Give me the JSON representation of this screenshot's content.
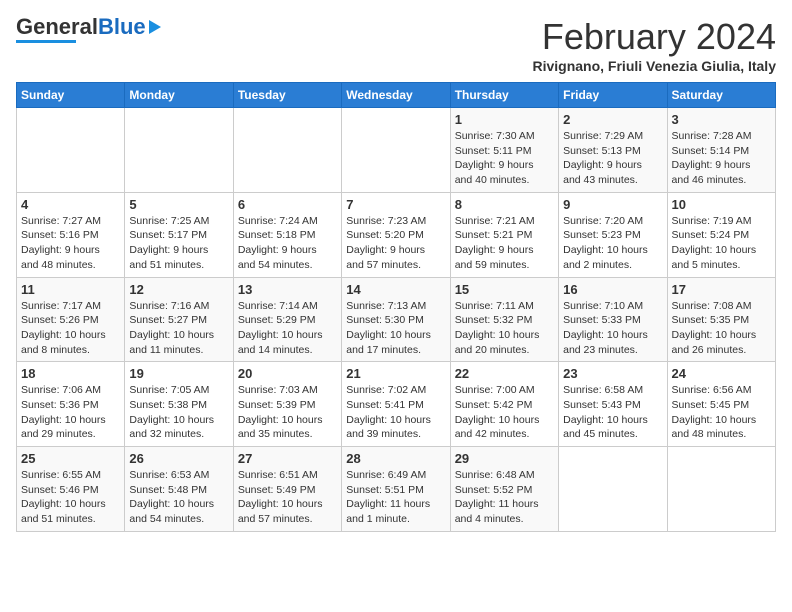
{
  "header": {
    "logo_general": "General",
    "logo_blue": "Blue",
    "title": "February 2024",
    "location": "Rivignano, Friuli Venezia Giulia, Italy"
  },
  "days_of_week": [
    "Sunday",
    "Monday",
    "Tuesday",
    "Wednesday",
    "Thursday",
    "Friday",
    "Saturday"
  ],
  "weeks": [
    [
      {
        "num": "",
        "info": ""
      },
      {
        "num": "",
        "info": ""
      },
      {
        "num": "",
        "info": ""
      },
      {
        "num": "",
        "info": ""
      },
      {
        "num": "1",
        "info": "Sunrise: 7:30 AM\nSunset: 5:11 PM\nDaylight: 9 hours\nand 40 minutes."
      },
      {
        "num": "2",
        "info": "Sunrise: 7:29 AM\nSunset: 5:13 PM\nDaylight: 9 hours\nand 43 minutes."
      },
      {
        "num": "3",
        "info": "Sunrise: 7:28 AM\nSunset: 5:14 PM\nDaylight: 9 hours\nand 46 minutes."
      }
    ],
    [
      {
        "num": "4",
        "info": "Sunrise: 7:27 AM\nSunset: 5:16 PM\nDaylight: 9 hours\nand 48 minutes."
      },
      {
        "num": "5",
        "info": "Sunrise: 7:25 AM\nSunset: 5:17 PM\nDaylight: 9 hours\nand 51 minutes."
      },
      {
        "num": "6",
        "info": "Sunrise: 7:24 AM\nSunset: 5:18 PM\nDaylight: 9 hours\nand 54 minutes."
      },
      {
        "num": "7",
        "info": "Sunrise: 7:23 AM\nSunset: 5:20 PM\nDaylight: 9 hours\nand 57 minutes."
      },
      {
        "num": "8",
        "info": "Sunrise: 7:21 AM\nSunset: 5:21 PM\nDaylight: 9 hours\nand 59 minutes."
      },
      {
        "num": "9",
        "info": "Sunrise: 7:20 AM\nSunset: 5:23 PM\nDaylight: 10 hours\nand 2 minutes."
      },
      {
        "num": "10",
        "info": "Sunrise: 7:19 AM\nSunset: 5:24 PM\nDaylight: 10 hours\nand 5 minutes."
      }
    ],
    [
      {
        "num": "11",
        "info": "Sunrise: 7:17 AM\nSunset: 5:26 PM\nDaylight: 10 hours\nand 8 minutes."
      },
      {
        "num": "12",
        "info": "Sunrise: 7:16 AM\nSunset: 5:27 PM\nDaylight: 10 hours\nand 11 minutes."
      },
      {
        "num": "13",
        "info": "Sunrise: 7:14 AM\nSunset: 5:29 PM\nDaylight: 10 hours\nand 14 minutes."
      },
      {
        "num": "14",
        "info": "Sunrise: 7:13 AM\nSunset: 5:30 PM\nDaylight: 10 hours\nand 17 minutes."
      },
      {
        "num": "15",
        "info": "Sunrise: 7:11 AM\nSunset: 5:32 PM\nDaylight: 10 hours\nand 20 minutes."
      },
      {
        "num": "16",
        "info": "Sunrise: 7:10 AM\nSunset: 5:33 PM\nDaylight: 10 hours\nand 23 minutes."
      },
      {
        "num": "17",
        "info": "Sunrise: 7:08 AM\nSunset: 5:35 PM\nDaylight: 10 hours\nand 26 minutes."
      }
    ],
    [
      {
        "num": "18",
        "info": "Sunrise: 7:06 AM\nSunset: 5:36 PM\nDaylight: 10 hours\nand 29 minutes."
      },
      {
        "num": "19",
        "info": "Sunrise: 7:05 AM\nSunset: 5:38 PM\nDaylight: 10 hours\nand 32 minutes."
      },
      {
        "num": "20",
        "info": "Sunrise: 7:03 AM\nSunset: 5:39 PM\nDaylight: 10 hours\nand 35 minutes."
      },
      {
        "num": "21",
        "info": "Sunrise: 7:02 AM\nSunset: 5:41 PM\nDaylight: 10 hours\nand 39 minutes."
      },
      {
        "num": "22",
        "info": "Sunrise: 7:00 AM\nSunset: 5:42 PM\nDaylight: 10 hours\nand 42 minutes."
      },
      {
        "num": "23",
        "info": "Sunrise: 6:58 AM\nSunset: 5:43 PM\nDaylight: 10 hours\nand 45 minutes."
      },
      {
        "num": "24",
        "info": "Sunrise: 6:56 AM\nSunset: 5:45 PM\nDaylight: 10 hours\nand 48 minutes."
      }
    ],
    [
      {
        "num": "25",
        "info": "Sunrise: 6:55 AM\nSunset: 5:46 PM\nDaylight: 10 hours\nand 51 minutes."
      },
      {
        "num": "26",
        "info": "Sunrise: 6:53 AM\nSunset: 5:48 PM\nDaylight: 10 hours\nand 54 minutes."
      },
      {
        "num": "27",
        "info": "Sunrise: 6:51 AM\nSunset: 5:49 PM\nDaylight: 10 hours\nand 57 minutes."
      },
      {
        "num": "28",
        "info": "Sunrise: 6:49 AM\nSunset: 5:51 PM\nDaylight: 11 hours\nand 1 minute."
      },
      {
        "num": "29",
        "info": "Sunrise: 6:48 AM\nSunset: 5:52 PM\nDaylight: 11 hours\nand 4 minutes."
      },
      {
        "num": "",
        "info": ""
      },
      {
        "num": "",
        "info": ""
      }
    ]
  ]
}
